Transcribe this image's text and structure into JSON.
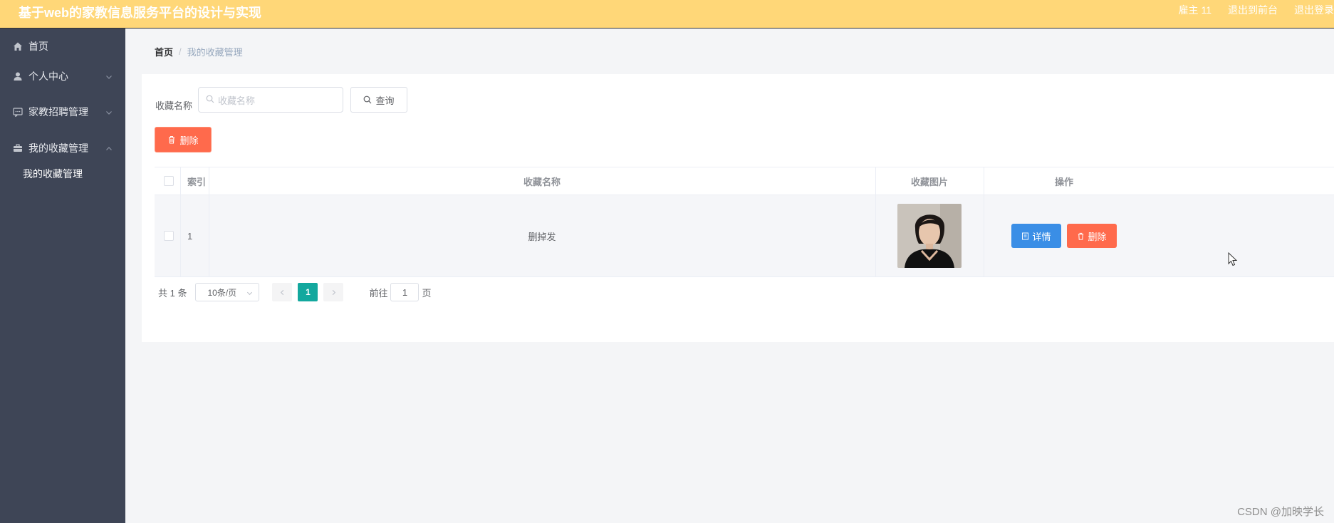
{
  "header": {
    "title": "基于web的家教信息服务平台的设计与实现",
    "user": "雇主 11",
    "to_front": "退出到前台",
    "logout": "退出登录"
  },
  "sidebar": {
    "items": [
      {
        "label": "首页",
        "icon": "home-icon"
      },
      {
        "label": "个人中心",
        "icon": "user-icon",
        "expandable": true
      },
      {
        "label": "家教招聘管理",
        "icon": "chat-icon",
        "expandable": true
      },
      {
        "label": "我的收藏管理",
        "icon": "briefcase-icon",
        "expandable": true,
        "expanded": true
      }
    ],
    "subitems": [
      {
        "label": "我的收藏管理"
      }
    ]
  },
  "breadcrumb": {
    "home": "首页",
    "separator": "/",
    "current": "我的收藏管理"
  },
  "search": {
    "label": "收藏名称",
    "placeholder": "收藏名称",
    "query_button": "查询"
  },
  "actions": {
    "delete_button": "删除"
  },
  "table": {
    "columns": [
      "索引",
      "收藏名称",
      "收藏图片",
      "操作"
    ],
    "rows": [
      {
        "index": "1",
        "name": "删掉发",
        "detail_button": "详情",
        "delete_button": "删除"
      }
    ]
  },
  "pagination": {
    "total": "共 1 条",
    "page_size": "10条/页",
    "current_page": "1",
    "goto_label": "前往",
    "goto_value": "1",
    "page_suffix": "页"
  },
  "watermark": "CSDN @加映学长",
  "colors": {
    "header_bg": "#ffd778",
    "sidebar_bg": "#3e4556",
    "primary": "#3a8ee6",
    "danger": "#ff6a4c",
    "page_active": "#13a89e"
  }
}
